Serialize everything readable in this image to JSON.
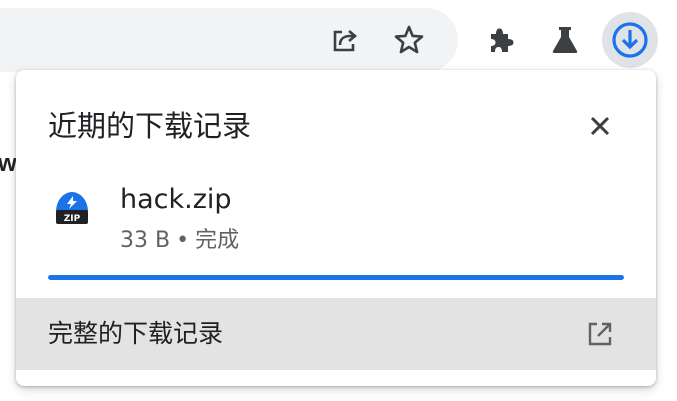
{
  "toolbar": {
    "share_icon": "share-icon",
    "bookmark_icon": "star-icon",
    "extensions_icon": "puzzle-icon",
    "labs_icon": "flask-icon",
    "downloads_icon": "download-icon"
  },
  "page": {
    "edge_text": "w"
  },
  "download_bubble": {
    "title": "近期的下载记录",
    "close_icon": "close-icon",
    "item": {
      "file_name": "hack.zip",
      "file_type_icon": "zip-file-icon",
      "size": "33 B",
      "separator": "•",
      "state": "完成",
      "progress_percent": 100
    },
    "footer": {
      "label": "完整的下载记录",
      "icon": "open-in-new-icon"
    }
  },
  "colors": {
    "accent": "#1a73e8",
    "text_primary": "#202124",
    "text_secondary": "#5f6368",
    "omnibox_bg": "#f1f3f4",
    "footer_bg": "#e3e3e3",
    "active_button_bg": "#dfe3e8"
  }
}
